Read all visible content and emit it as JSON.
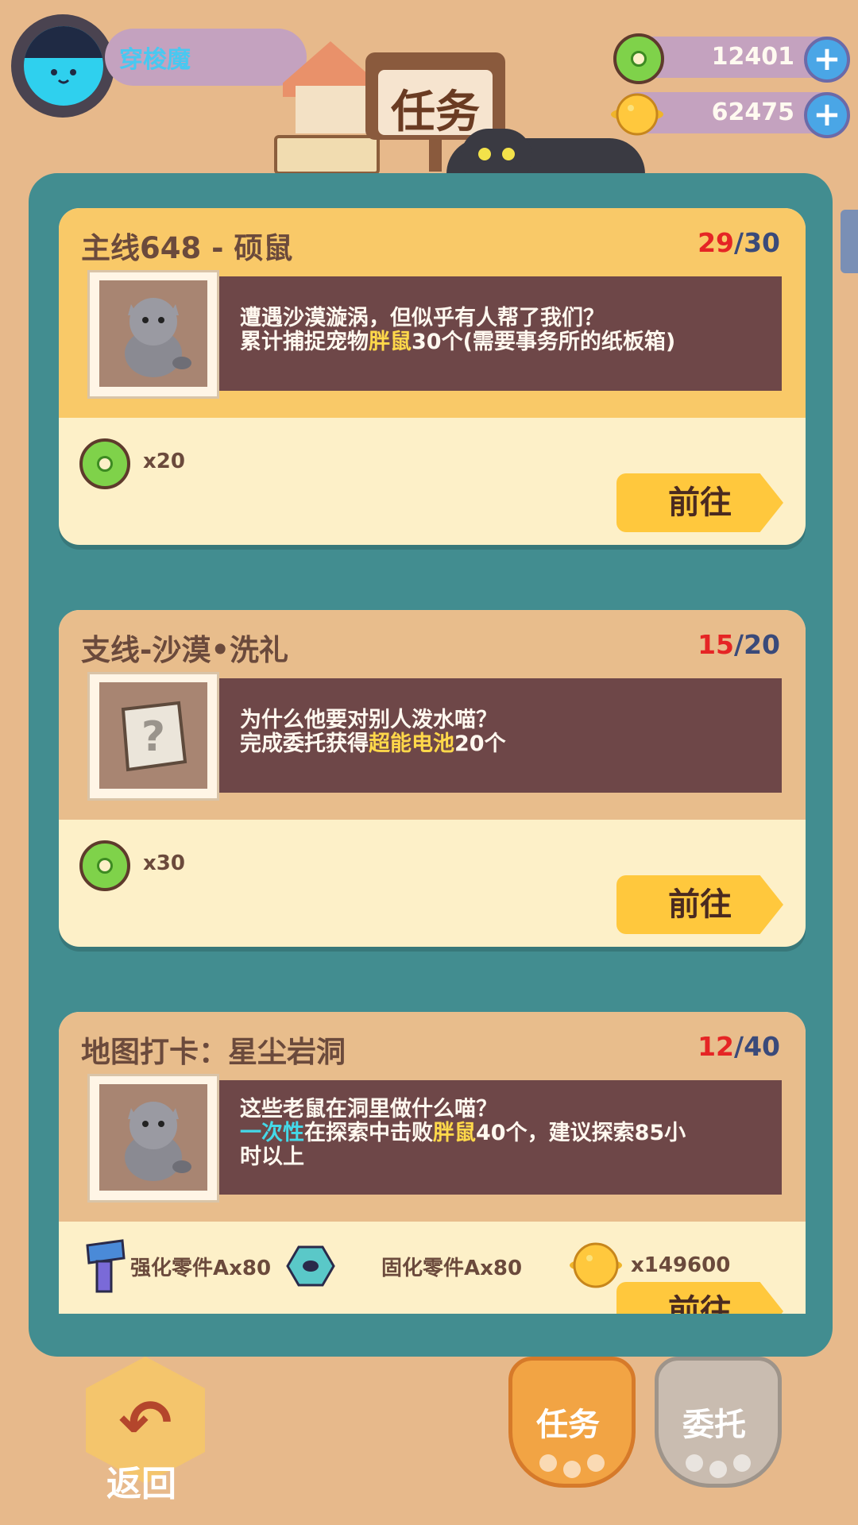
{
  "player": {
    "name": "穿梭魔"
  },
  "resources": [
    {
      "name": "gear-coin",
      "value": "12401"
    },
    {
      "name": "gold-planet-coin",
      "value": "62475"
    }
  ],
  "title": "任务",
  "tasks": [
    {
      "title": "主线648 - 硕鼠",
      "progress_current": "29",
      "progress_rest": "/30",
      "desc": [
        [
          {
            "t": "遭遇沙漠漩涡，但似乎有人帮了我们？"
          }
        ],
        [
          {
            "t": "累计捕捉宠物"
          },
          {
            "t": "胖鼠",
            "c": "yellow"
          },
          {
            "t": "30个(需要事务所的纸板箱)"
          }
        ]
      ],
      "image": "fat-mouse",
      "rewards": [
        {
          "icon": "gear-coin",
          "label": "x20"
        }
      ],
      "button": "前往"
    },
    {
      "title": "支线-沙漠•洗礼",
      "progress_current": "15",
      "progress_rest": "/20",
      "desc": [
        [
          {
            "t": "为什么他要对别人泼水喵？"
          }
        ],
        [
          {
            "t": "完成委托获得"
          },
          {
            "t": "超能电池",
            "c": "yellow"
          },
          {
            "t": "20个"
          }
        ]
      ],
      "image": "unknown-note",
      "rewards": [
        {
          "icon": "gear-coin",
          "label": "x30"
        }
      ],
      "button": "前往"
    },
    {
      "title": "地图打卡：星尘岩洞",
      "progress_current": "12",
      "progress_rest": "/40",
      "desc": [
        [
          {
            "t": "这些老鼠在洞里做什么喵？"
          }
        ],
        [
          {
            "t": "一次性",
            "c": "cyan"
          },
          {
            "t": "在探索中击败"
          },
          {
            "t": "胖鼠",
            "c": "yellow"
          },
          {
            "t": "40个，建议探索85小"
          }
        ],
        [
          {
            "t": "时以上"
          }
        ]
      ],
      "image": "fat-mouse",
      "rewards": [
        {
          "icon": "screw-part",
          "label": "强化零件Ax80"
        },
        {
          "icon": "nut-part",
          "label": "固化零件Ax80"
        },
        {
          "icon": "gold-planet-coin",
          "label": "x149600"
        }
      ],
      "button": "前往"
    }
  ],
  "bottom": {
    "back_label": "返回",
    "tab_task": "任务",
    "tab_entrust": "委托"
  },
  "colors": {
    "panel": "#428d90",
    "highlight_yellow": "#ffd84a",
    "highlight_cyan": "#44d8e8",
    "progress_current": "#e52525"
  }
}
